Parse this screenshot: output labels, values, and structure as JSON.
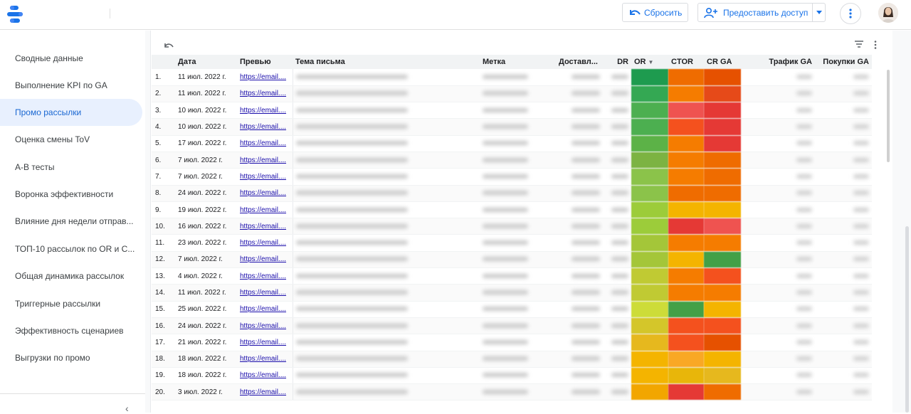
{
  "header": {
    "reset_label": "Сбросить",
    "share_label": "Предоставить доступ"
  },
  "sidebar": {
    "items": [
      {
        "label": "Сводные данные"
      },
      {
        "label": "Выполнение KPI по GA"
      },
      {
        "label": "Промо рассылки"
      },
      {
        "label": "Оценка смены ToV"
      },
      {
        "label": "A-B тесты"
      },
      {
        "label": "Воронка эффективности"
      },
      {
        "label": "Влияние дня недели отправ..."
      },
      {
        "label": "ТОП-10 рассылок по OR и C..."
      },
      {
        "label": "Общая динамика рассылок"
      },
      {
        "label": "Триггерные рассылки"
      },
      {
        "label": "Эффективность сценариев"
      },
      {
        "label": "Выгрузки по промо"
      }
    ],
    "active_index": 2,
    "collapse_glyph": "‹"
  },
  "table": {
    "columns": [
      "Дата",
      "Превью",
      "Тема письма",
      "Метка",
      "Доставл...",
      "DR",
      "OR",
      "CTOR",
      "CR GA",
      "Трафик GA",
      "Покупки GA"
    ],
    "rows": [
      {
        "n": "1.",
        "date": "11 июл. 2022 г.",
        "preview": "https://email...."
      },
      {
        "n": "2.",
        "date": "11 июл. 2022 г.",
        "preview": "https://email...."
      },
      {
        "n": "3.",
        "date": "10 июл. 2022 г.",
        "preview": "https://email...."
      },
      {
        "n": "4.",
        "date": "10 июл. 2022 г.",
        "preview": "https://email...."
      },
      {
        "n": "5.",
        "date": "17 июл. 2022 г.",
        "preview": "https://email...."
      },
      {
        "n": "6.",
        "date": "7 июл. 2022 г.",
        "preview": "https://email...."
      },
      {
        "n": "7.",
        "date": "7 июл. 2022 г.",
        "preview": "https://email...."
      },
      {
        "n": "8.",
        "date": "24 июл. 2022 г.",
        "preview": "https://email...."
      },
      {
        "n": "9.",
        "date": "19 июл. 2022 г.",
        "preview": "https://email...."
      },
      {
        "n": "10.",
        "date": "16 июл. 2022 г.",
        "preview": "https://email...."
      },
      {
        "n": "11.",
        "date": "23 июл. 2022 г.",
        "preview": "https://email...."
      },
      {
        "n": "12.",
        "date": "7 июл. 2022 г.",
        "preview": "https://email...."
      },
      {
        "n": "13.",
        "date": "4 июл. 2022 г.",
        "preview": "https://email...."
      },
      {
        "n": "14.",
        "date": "11 июл. 2022 г.",
        "preview": "https://email...."
      },
      {
        "n": "15.",
        "date": "25 июл. 2022 г.",
        "preview": "https://email...."
      },
      {
        "n": "16.",
        "date": "24 июл. 2022 г.",
        "preview": "https://email...."
      },
      {
        "n": "17.",
        "date": "21 июл. 2022 г.",
        "preview": "https://email...."
      },
      {
        "n": "18.",
        "date": "18 июл. 2022 г.",
        "preview": "https://email...."
      },
      {
        "n": "19.",
        "date": "18 июл. 2022 г.",
        "preview": "https://email...."
      },
      {
        "n": "20.",
        "date": "3 июл. 2022 г.",
        "preview": "https://email...."
      }
    ],
    "heat_colors": {
      "or": [
        "#1e9b4f",
        "#34a853",
        "#4caf50",
        "#4caf50",
        "#5cb247",
        "#7cb342",
        "#8bc34a",
        "#8bc34a",
        "#9ccc3a",
        "#9ccc3a",
        "#a4c639",
        "#a4c639",
        "#c0ca33",
        "#c0ca33",
        "#cddc39",
        "#d4c62a",
        "#e6b81e",
        "#f4b400",
        "#f4b400",
        "#f2a600"
      ],
      "ctor": [
        "#ef6c00",
        "#f57c00",
        "#ef5350",
        "#f4511e",
        "#f57c00",
        "#f57c00",
        "#f57c00",
        "#ef6c00",
        "#f4b400",
        "#e53935",
        "#f57c00",
        "#f4b400",
        "#f57c00",
        "#f57c00",
        "#43a047",
        "#f4511e",
        "#f4511e",
        "#f9a825",
        "#e8b60a",
        "#e53935"
      ],
      "crga": [
        "#e65100",
        "#e64a19",
        "#e53935",
        "#e53935",
        "#e53935",
        "#ef6c00",
        "#ef6c00",
        "#ef6c00",
        "#f4b400",
        "#ef5350",
        "#f57c00",
        "#43a047",
        "#f4511e",
        "#f57c00",
        "#f4b400",
        "#f4511e",
        "#e65100",
        "#f4b400",
        "#e6b81e",
        "#ef6c00"
      ]
    }
  }
}
